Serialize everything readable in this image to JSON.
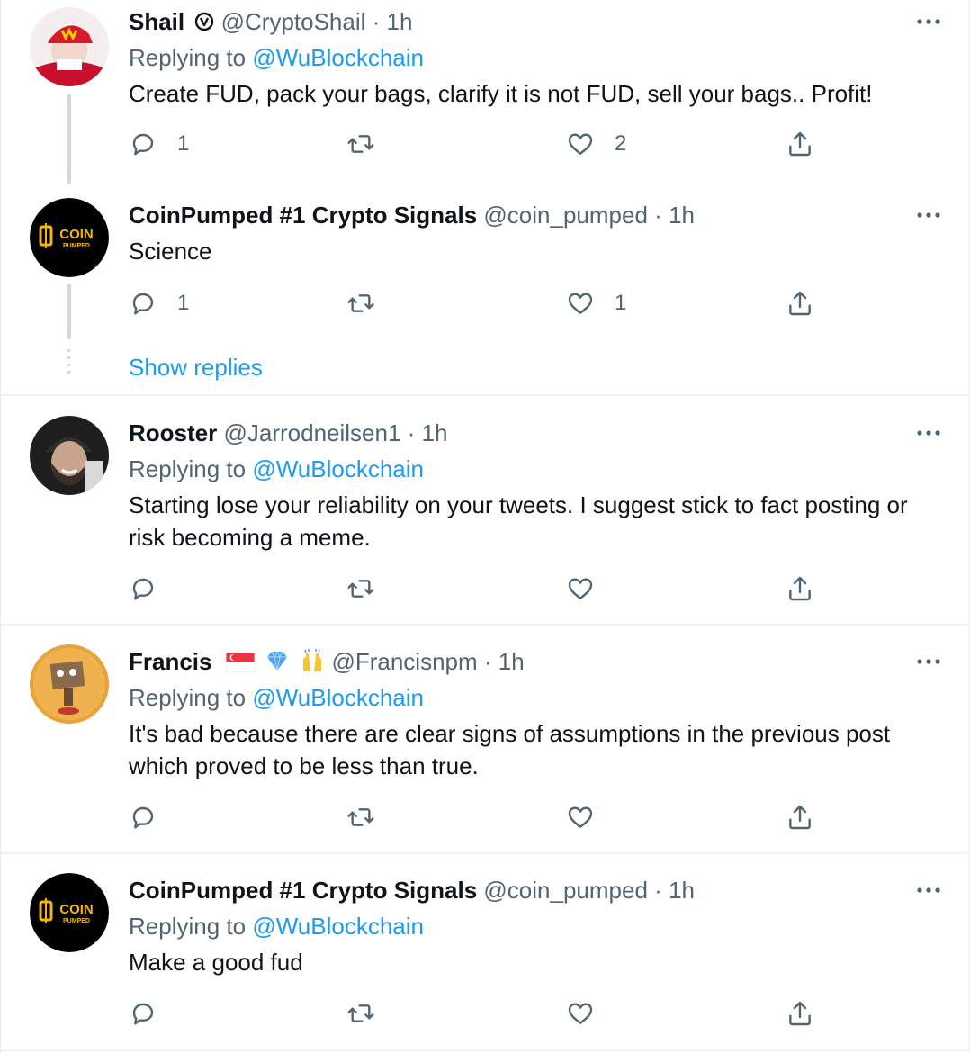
{
  "tweets": [
    {
      "name": "Shail",
      "handle": "@CryptoShail",
      "sep": "·",
      "time": "1h",
      "verified_icon": "circle-v-badge-icon",
      "replying_label": "Replying to",
      "replying_to": "@WuBlockchain",
      "text": "Create FUD, pack your bags, clarify it is not FUD, sell your bags.. Profit!",
      "replies": "1",
      "retweets": "",
      "likes": "2"
    },
    {
      "name": "CoinPumped #1 Crypto Signals",
      "handle": "@coin_pumped",
      "sep": "·",
      "time": "1h",
      "text": "Science",
      "replies": "1",
      "retweets": "",
      "likes": "1"
    },
    {
      "name": "Rooster",
      "handle": "@Jarrodneilsen1",
      "sep": "·",
      "time": "1h",
      "replying_label": "Replying to",
      "replying_to": "@WuBlockchain",
      "text": "Starting lose your reliability on your tweets. I suggest stick to fact posting or risk becoming a meme.",
      "replies": "",
      "retweets": "",
      "likes": ""
    },
    {
      "name": "Francis",
      "handle": "@Francisnpm",
      "sep": "·",
      "time": "1h",
      "name_emojis": [
        "flag-singapore-icon",
        "gem-icon",
        "raising-hands-icon"
      ],
      "replying_label": "Replying to",
      "replying_to": "@WuBlockchain",
      "text": "It's bad because there are clear signs of assumptions in the previous post which proved to be less than true.",
      "replies": "",
      "retweets": "",
      "likes": ""
    },
    {
      "name": "CoinPumped #1 Crypto Signals",
      "handle": "@coin_pumped",
      "sep": "·",
      "time": "1h",
      "replying_label": "Replying to",
      "replying_to": "@WuBlockchain",
      "text": "Make a good fud",
      "replies": "",
      "retweets": "",
      "likes": ""
    }
  ],
  "show_replies_label": "Show replies",
  "logo_text": {
    "top": "COIN",
    "bottom": "PUMPED"
  },
  "colors": {
    "link": "#1d9bf0",
    "muted": "#536471",
    "text": "#0f1419",
    "thread": "#cfd9de",
    "coin_gold": "#f5b800"
  }
}
